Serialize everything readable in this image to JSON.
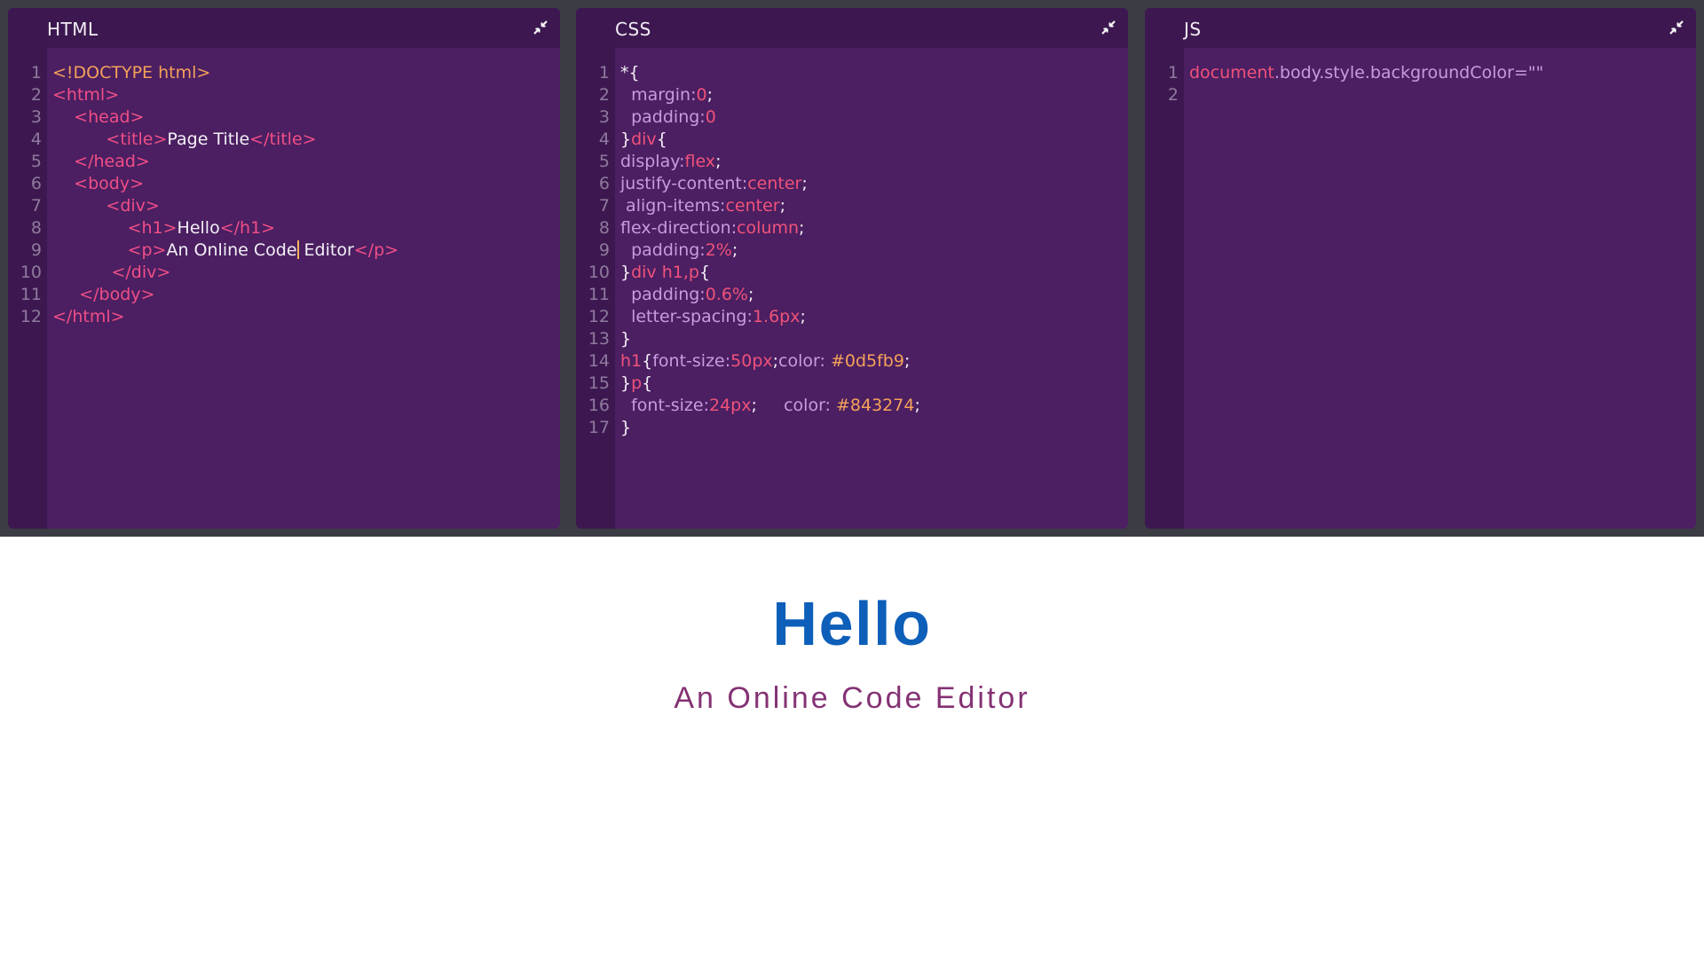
{
  "panels": {
    "html": {
      "title": "HTML",
      "line_count": 12
    },
    "css": {
      "title": "CSS",
      "line_count": 17
    },
    "js": {
      "title": "JS",
      "line_count": 2
    }
  },
  "html_code": {
    "l1": "<!DOCTYPE html>",
    "l2_open": "<html>",
    "l3": "<head>",
    "l4_open": "<title>",
    "l4_text": "Page Title",
    "l4_close": "</title>",
    "l5": "</head>",
    "l6": "<body>",
    "l7": "<div>",
    "l8_open": "<h1>",
    "l8_text": "Hello",
    "l8_close": "</h1>",
    "l9_open": "<p>",
    "l9_text_a": "An Online Code",
    "l9_text_b": " Editor",
    "l9_close": "</p>",
    "l10": "</div>",
    "l11": "</body>",
    "l12": "</html>"
  },
  "css_code": {
    "l1": "*{",
    "l2_p": "margin:",
    "l2_v": "0",
    "l2_e": ";",
    "l3_p": "padding:",
    "l3_v": "0",
    "l4_a": "}",
    "l4_s": "div",
    "l4_b": "{",
    "l5_p": "display:",
    "l5_v": "flex",
    "l5_e": ";",
    "l6_p": "justify-content:",
    "l6_v": "center",
    "l6_e": ";",
    "l7_p": "align-items:",
    "l7_v": "center",
    "l7_e": ";",
    "l8_p": "flex-direction:",
    "l8_v": "column",
    "l8_e": ";",
    "l9_p": "padding:",
    "l9_v": "2%",
    "l9_e": ";",
    "l10_a": "}",
    "l10_s": "div h1,p",
    "l10_b": "{",
    "l11_p": "padding:",
    "l11_v": "0.6%",
    "l11_e": ";",
    "l12_p": "letter-spacing:",
    "l12_v": "1.6px",
    "l12_e": ";",
    "l13": "}",
    "l14_s": "h1",
    "l14_b": "{",
    "l14_p1": "font-size:",
    "l14_v1": "50px",
    "l14_e1": ";",
    "l14_p2": "color: ",
    "l14_v2": "#0d5fb9",
    "l14_e2": ";",
    "l15_a": "}",
    "l15_s": "p",
    "l15_b": "{",
    "l16_p1": "font-size:",
    "l16_v1": "24px",
    "l16_e1": ";",
    "l16_p2": "color: ",
    "l16_v2": "#843274",
    "l16_e2": ";",
    "l17": "}"
  },
  "js_code": {
    "l1_obj": "document",
    "l1_rest": ".body.style.backgroundColor=\"\""
  },
  "preview": {
    "heading": "Hello",
    "paragraph": "An Online Code Editor"
  },
  "colors": {
    "editor_bg": "#4b1f62",
    "header_bg": "#3d1850",
    "outer_bg": "#3c3c44",
    "heading": "#0d5fb9",
    "paragraph": "#843274"
  },
  "icons": {
    "minimize": "minimize-arrows-icon"
  }
}
